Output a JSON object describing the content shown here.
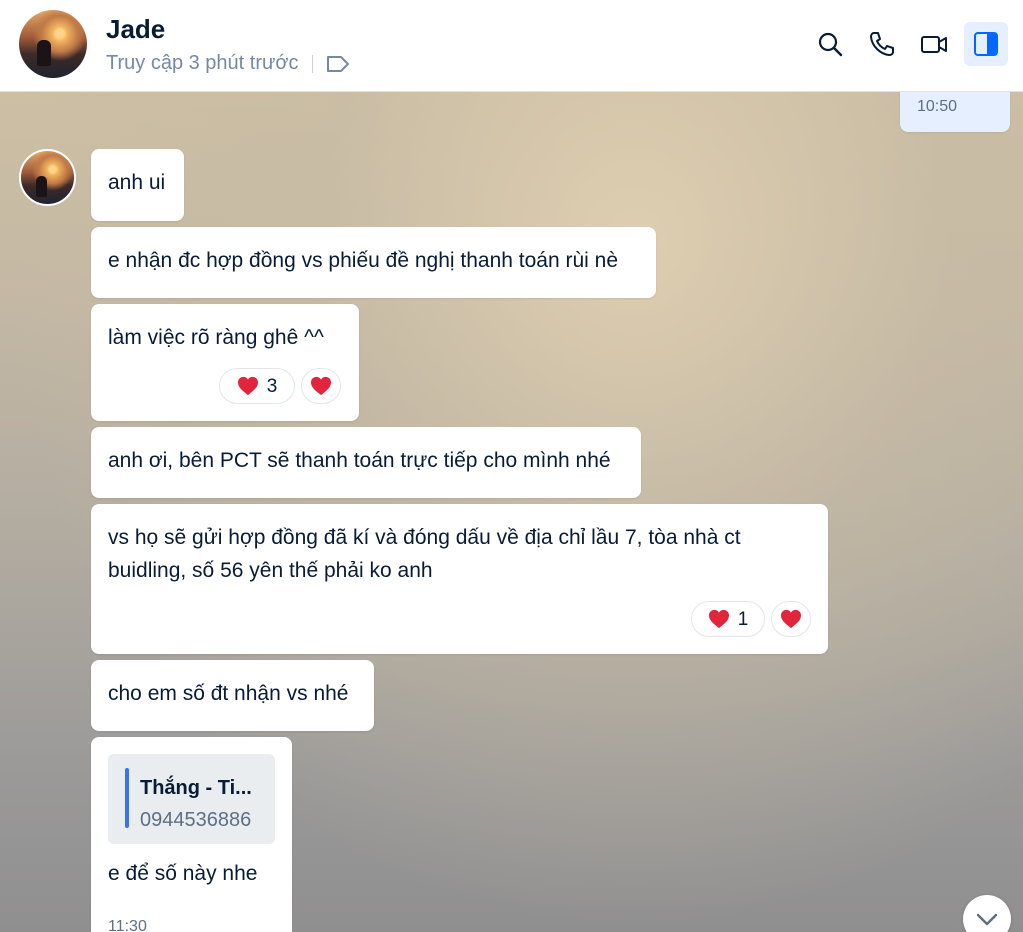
{
  "header": {
    "contact_name": "Jade",
    "presence": "Truy cập 3 phút trước",
    "icons": [
      "tag-icon",
      "search-icon",
      "phone-icon",
      "video-icon",
      "sidebar-toggle-icon"
    ]
  },
  "colors": {
    "accent": "#0068ff",
    "out_bubble": "#e5efff",
    "reaction_heart": "#e0253d"
  },
  "messages": {
    "outgoing_time": "10:50",
    "m1": "anh ui",
    "m2": "e nhận đc hợp đồng vs phiếu đề nghị thanh toán rùi nè",
    "m3": "làm việc rõ ràng ghê ^^",
    "m3_reaction_count": "3",
    "m4": "anh ơi, bên PCT sẽ thanh toán trực tiếp cho mình nhé",
    "m5_line1": "vs họ sẽ gửi hợp đồng đã kí và đóng dấu về địa chỉ lầu 7, tòa nhà ct",
    "m5_line2": "buidling, số 56 yên thế phải ko anh",
    "m5_reaction_count": "1",
    "m6": "cho em số đt nhận vs nhé",
    "m7_quote_name": "Thắng - Ti...",
    "m7_quote_phone": "0944536886",
    "m7_text": "e để số này nhe",
    "m7_time": "11:30"
  }
}
